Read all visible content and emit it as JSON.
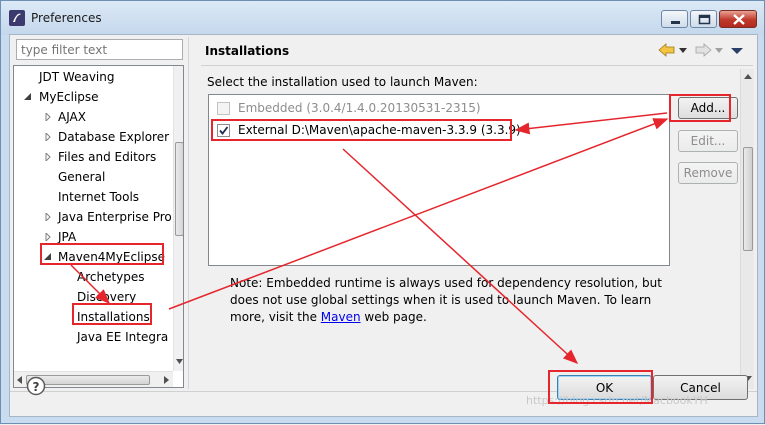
{
  "window": {
    "title": "Preferences",
    "colors": {
      "annotation": "#e5262d",
      "link": "#0000ee",
      "titlebar": "#c4d7ec"
    }
  },
  "filter": {
    "placeholder": "type filter text"
  },
  "tree": {
    "items": [
      {
        "label": "JDT Weaving"
      },
      {
        "label": "MyEclipse"
      },
      {
        "label": "AJAX"
      },
      {
        "label": "Database Explorer"
      },
      {
        "label": "Files and Editors"
      },
      {
        "label": "General"
      },
      {
        "label": "Internet Tools"
      },
      {
        "label": "Java Enterprise Pro"
      },
      {
        "label": "JPA"
      },
      {
        "label": "Maven4MyEclipse"
      },
      {
        "label": "Archetypes"
      },
      {
        "label": "Discovery"
      },
      {
        "label": "Installations"
      },
      {
        "label": "Java EE Integra"
      }
    ]
  },
  "page": {
    "title": "Installations",
    "intro": "Select the installation used to launch Maven:",
    "installations": [
      {
        "label": "Embedded (3.0.4/1.4.0.20130531-2315)",
        "checked": false,
        "enabled": false
      },
      {
        "label": "External D:\\Maven\\apache-maven-3.3.9 (3.3.9)",
        "checked": true,
        "enabled": true
      }
    ],
    "buttons": {
      "add": "Add...",
      "edit": "Edit...",
      "remove": "Remove"
    },
    "note": {
      "before": "Note: Embedded runtime is always used for dependency resolution, but does not use global settings when it is used to launch Maven. To learn more, visit the ",
      "link": "Maven",
      "after": " web page."
    }
  },
  "dialog": {
    "ok": "OK",
    "cancel": "Cancel"
  },
  "watermark": "https://blog.csdn.net/MacbookYH"
}
